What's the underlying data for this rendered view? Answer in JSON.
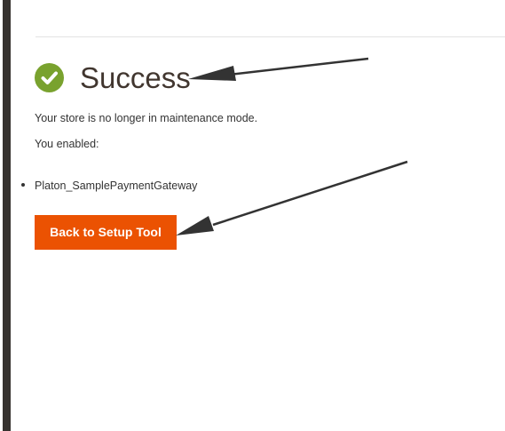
{
  "header": {
    "icon": "checkmark-circle-icon",
    "title": "Success"
  },
  "messages": {
    "maintenance": "Your store is no longer in maintenance mode.",
    "enabled_label": "You enabled:"
  },
  "enabled_modules": [
    "Platon_SamplePaymentGateway"
  ],
  "actions": {
    "back_label": "Back to Setup Tool"
  },
  "colors": {
    "success_green": "#79a22e",
    "button_orange": "#eb5202",
    "left_bar": "#373330",
    "annotation_arrow": "#333333"
  }
}
